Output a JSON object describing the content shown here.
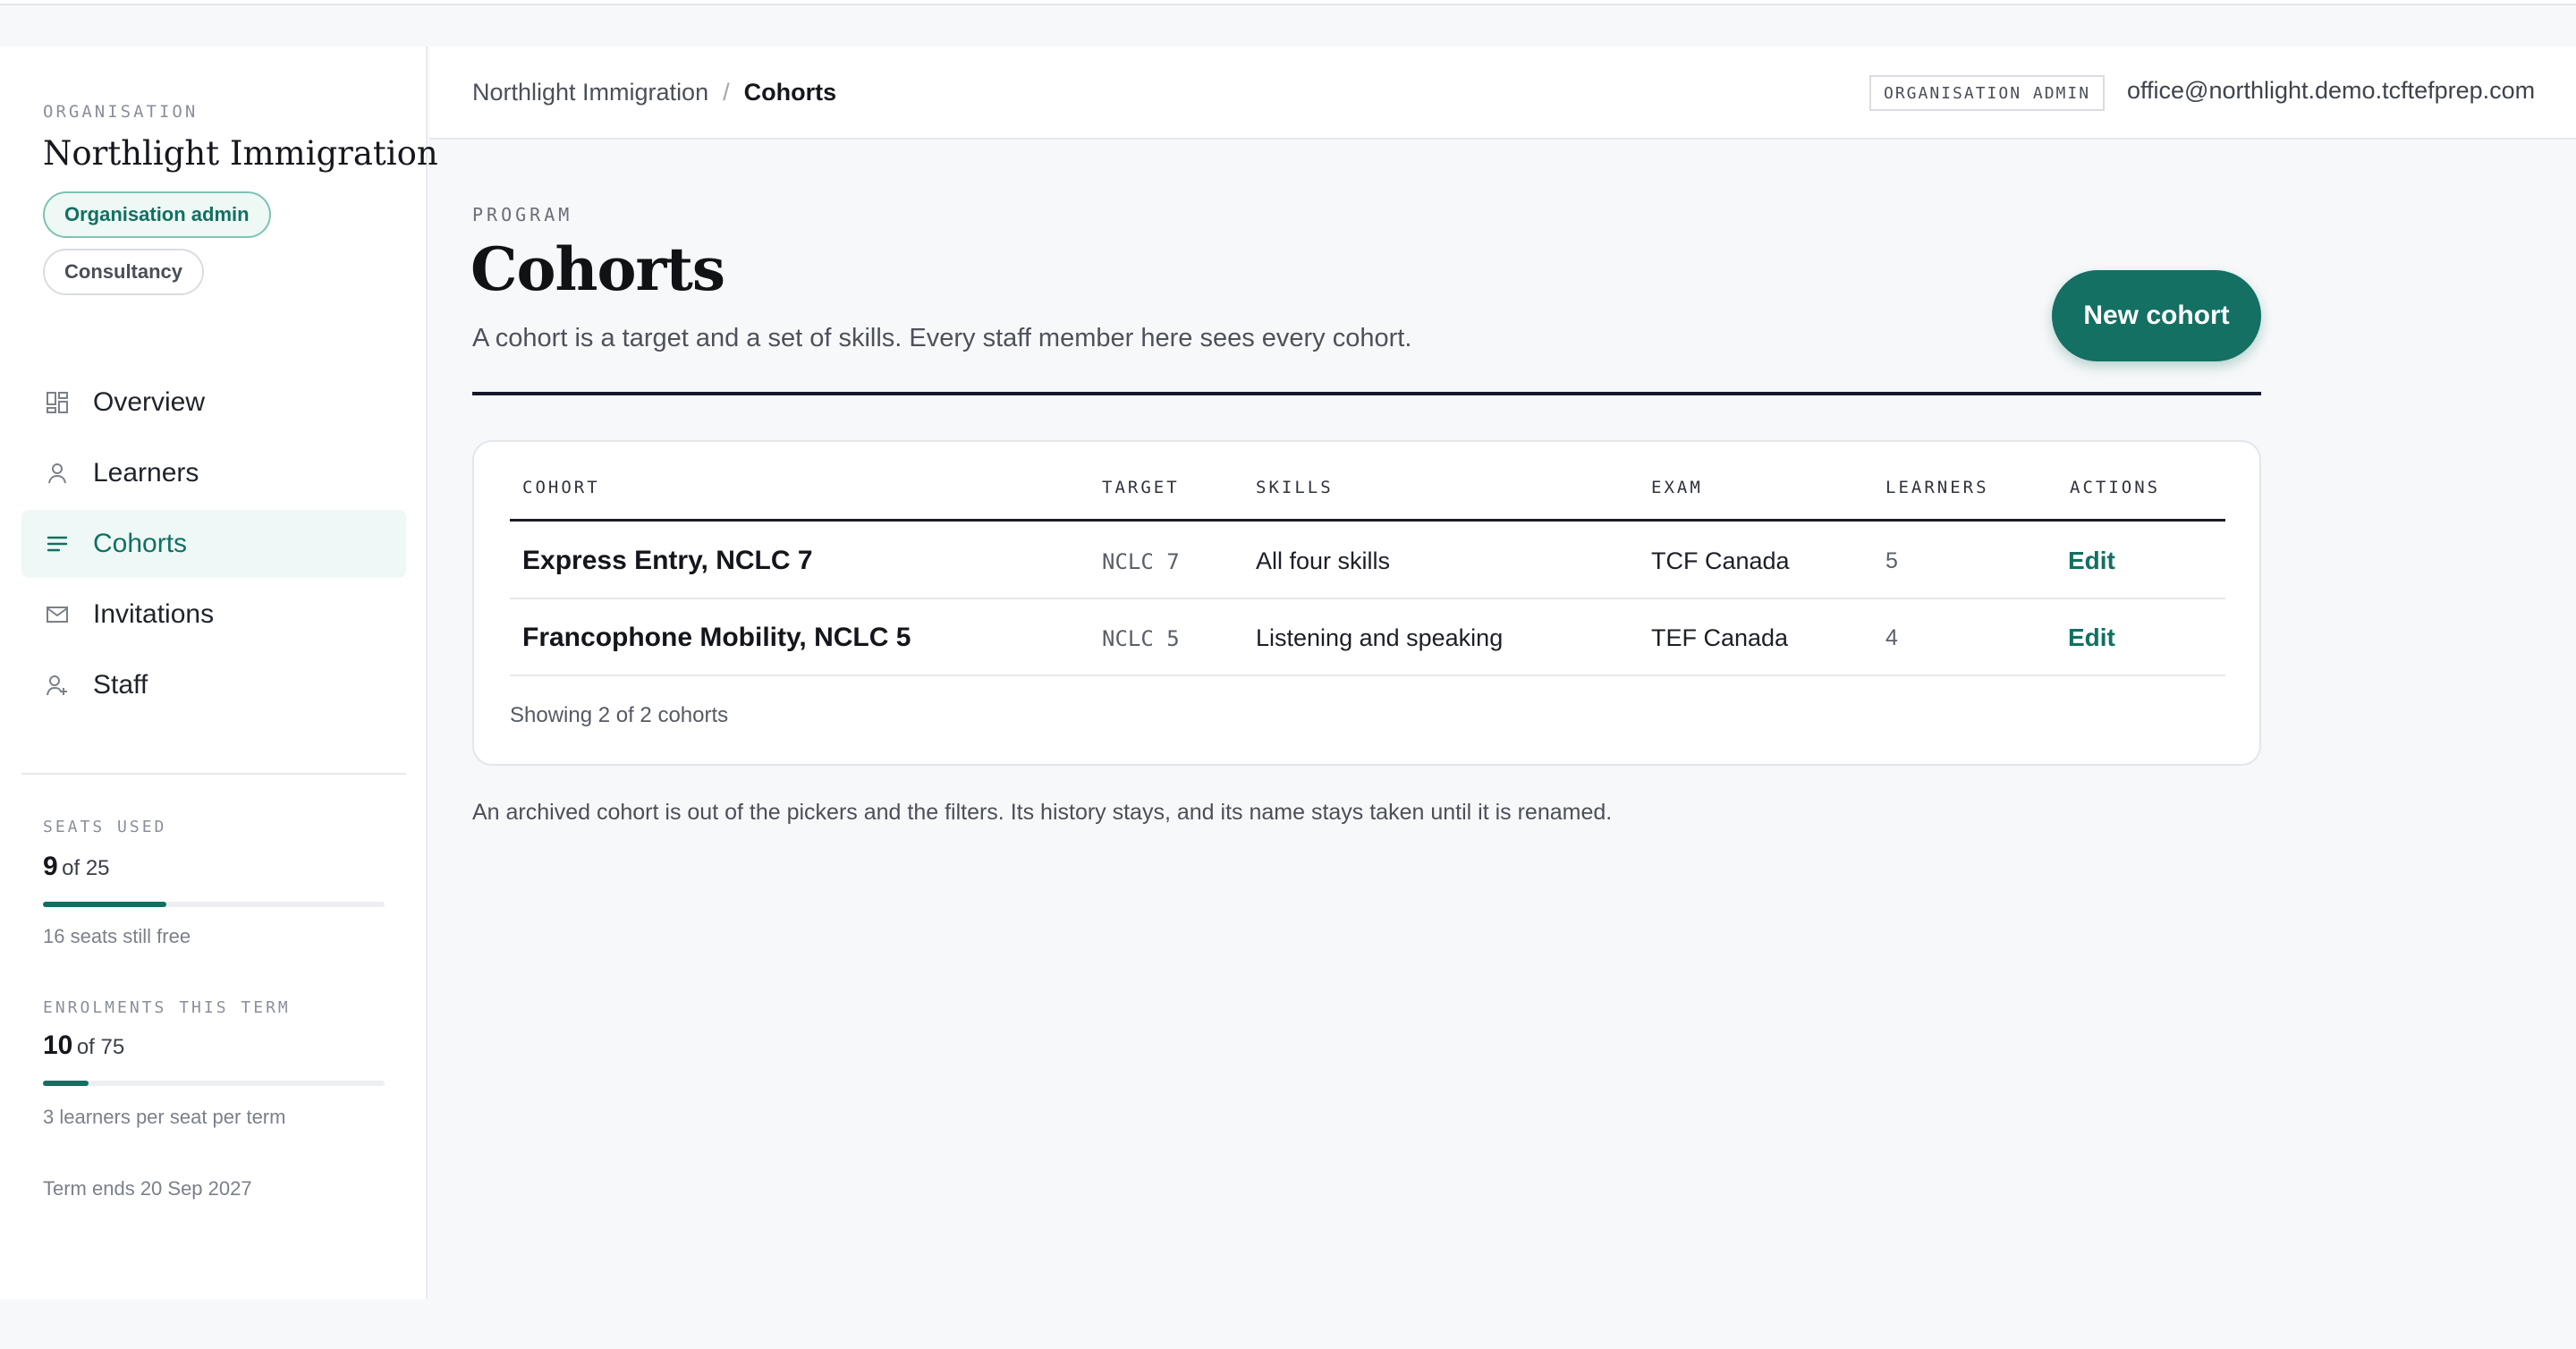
{
  "sidebar": {
    "org_label": "ORGANISATION",
    "org_name": "Northlight Immigration",
    "badges": [
      "Organisation admin",
      "Consultancy"
    ],
    "nav": [
      {
        "label": "Overview",
        "icon": "overview-icon",
        "active": false
      },
      {
        "label": "Learners",
        "icon": "user-icon",
        "active": false
      },
      {
        "label": "Cohorts",
        "icon": "list-icon",
        "active": true
      },
      {
        "label": "Invitations",
        "icon": "mail-icon",
        "active": false
      },
      {
        "label": "Staff",
        "icon": "add-user-icon",
        "active": false
      }
    ],
    "seats": {
      "label": "SEATS USED",
      "used": "9",
      "of": "of 25",
      "fraction": 0.36,
      "note": "16 seats still free"
    },
    "enrolments": {
      "label": "ENROLMENTS THIS TERM",
      "used": "10",
      "of": "of 75",
      "fraction": 0.133,
      "note": "3 learners per seat per term"
    },
    "term_end": "Term ends 20 Sep 2027"
  },
  "header": {
    "breadcrumb": [
      "Northlight Immigration",
      "Cohorts"
    ],
    "separator": "/",
    "role": "ORGANISATION ADMIN",
    "email": "office@northlight.demo.tcftefprep.com"
  },
  "main": {
    "eyebrow": "PROGRAM",
    "title": "Cohorts",
    "description": "A cohort is a target and a set of skills. Every staff member here sees every cohort.",
    "new_button": "New cohort",
    "table": {
      "columns": [
        "COHORT",
        "TARGET",
        "SKILLS",
        "EXAM",
        "LEARNERS",
        "ACTIONS"
      ],
      "rows": [
        {
          "cohort": "Express Entry, NCLC 7",
          "target": "NCLC 7",
          "skills": "All four skills",
          "exam": "TCF Canada",
          "learners": "5",
          "action": "Edit"
        },
        {
          "cohort": "Francophone Mobility, NCLC 5",
          "target": "NCLC 5",
          "skills": "Listening and speaking",
          "exam": "TEF Canada",
          "learners": "4",
          "action": "Edit"
        }
      ],
      "footer": "Showing 2 of 2 cohorts"
    },
    "archive_note": "An archived cohort is out of the pickers and the filters. Its history stays, and its name stays taken until it is renamed."
  },
  "colors": {
    "accent": "#117062",
    "accent_light": "#eef8f6",
    "rule": "#15172b"
  }
}
